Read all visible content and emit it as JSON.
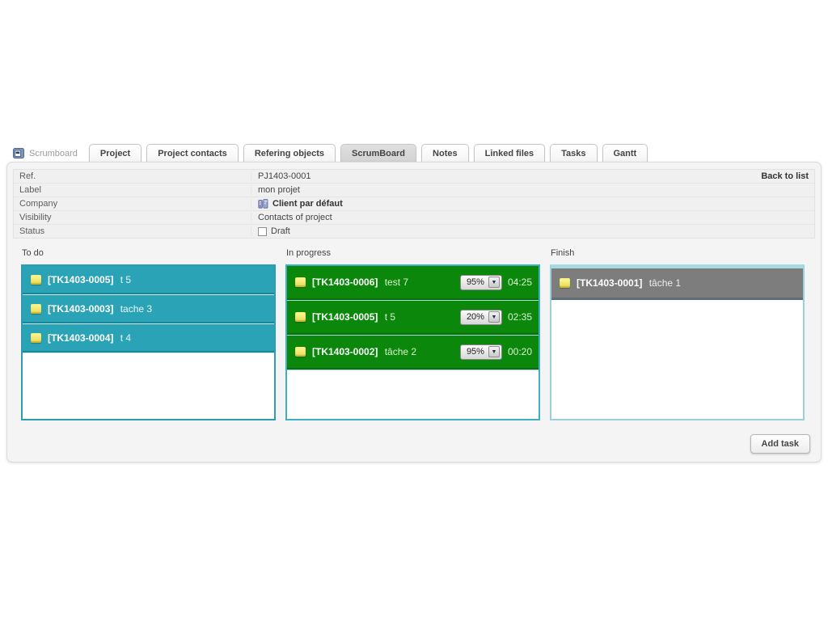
{
  "icons": {
    "dropdown_arrow": "▼"
  },
  "header_tabs": {
    "module_label": "Scrumboard",
    "items": [
      {
        "label": "Project",
        "active": false
      },
      {
        "label": "Project contacts",
        "active": false
      },
      {
        "label": "Refering objects",
        "active": false
      },
      {
        "label": "ScrumBoard",
        "active": true
      },
      {
        "label": "Notes",
        "active": false
      },
      {
        "label": "Linked files",
        "active": false
      },
      {
        "label": "Tasks",
        "active": false
      },
      {
        "label": "Gantt",
        "active": false
      }
    ]
  },
  "project": {
    "back_to_list": "Back to list",
    "rows": [
      {
        "label": "Ref.",
        "value": "PJ1403-0001"
      },
      {
        "label": "Label",
        "value": "mon projet"
      },
      {
        "label": "Company",
        "value": "Client par défaut"
      },
      {
        "label": "Visibility",
        "value": "Contacts of project"
      },
      {
        "label": "Status",
        "value": "Draft"
      }
    ]
  },
  "board": {
    "columns": [
      {
        "name": "To do",
        "type": "todo",
        "cards": [
          {
            "ref": "[TK1403-0005]",
            "title": "t 5"
          },
          {
            "ref": "[TK1403-0003]",
            "title": "tache 3"
          },
          {
            "ref": "[TK1403-0004]",
            "title": "t 4"
          }
        ]
      },
      {
        "name": "In progress",
        "type": "inprogress",
        "cards": [
          {
            "ref": "[TK1403-0006]",
            "title": "test 7",
            "progress": "95%",
            "time": "04:25"
          },
          {
            "ref": "[TK1403-0005]",
            "title": "t 5",
            "progress": "20%",
            "time": "02:35"
          },
          {
            "ref": "[TK1403-0002]",
            "title": "tâche 2",
            "progress": "95%",
            "time": "00:20"
          }
        ]
      },
      {
        "name": "Finish",
        "type": "finish",
        "cards": [
          {
            "ref": "[TK1403-0001]",
            "title": "tâche 1"
          }
        ]
      }
    ]
  },
  "actions": {
    "add_task_label": "Add task"
  },
  "colors": {
    "todo_card": "#2ba3b7",
    "inprogress_card": "#0b870b",
    "finish_card": "#7d7d7d",
    "column_border_teal": "#3aa7bb",
    "panel_bg": "#f4f4f4",
    "task_icon_yellow": "#efe05a"
  }
}
